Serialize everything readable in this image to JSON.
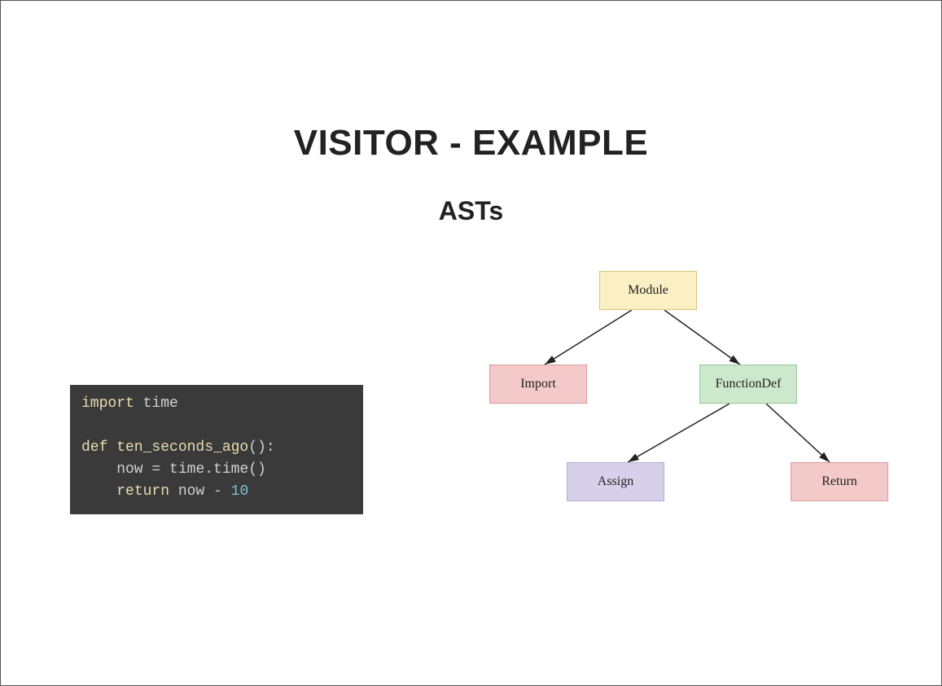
{
  "title": "VISITOR - EXAMPLE",
  "subtitle": "ASTs",
  "code": {
    "l1_kw": "import",
    "l1_rest": " time",
    "l2": "",
    "l3_kw": "def",
    "l3_fn": " ten_seconds_ago",
    "l3_rest": "():",
    "l4_pre": "    now ",
    "l4_op": "=",
    "l4_rest": " time.time()",
    "l5_pre": "    ",
    "l5_kw": "return",
    "l5_mid": " now ",
    "l5_op": "-",
    "l5_sp": " ",
    "l5_num": "10"
  },
  "diagram": {
    "nodes": {
      "module": "Module",
      "import": "Import",
      "functiondef": "FunctionDef",
      "assign": "Assign",
      "return": "Return"
    }
  }
}
